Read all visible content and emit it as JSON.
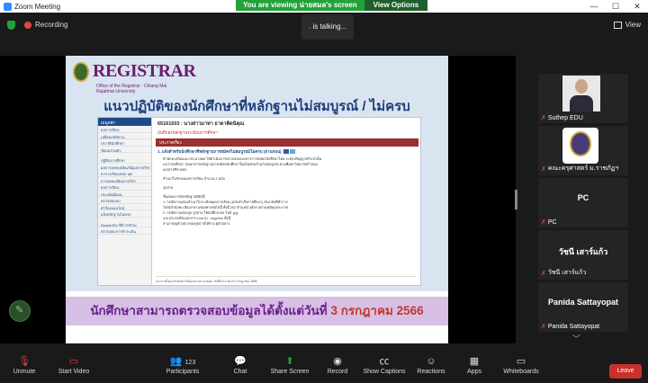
{
  "window": {
    "title": "Zoom Meeting",
    "controls": [
      "—",
      "☐",
      "✕"
    ]
  },
  "share_banner": {
    "viewing": "You are viewing น่ายสมล's screen",
    "options": "View Options"
  },
  "top": {
    "recording": "Recording",
    "talking": ". is talking...",
    "view": "View"
  },
  "slide": {
    "logo": {
      "mark": "REGISTRAR",
      "small": "Office of the Registrar · Chiang Mai Rajabhat University"
    },
    "title": "แนวปฏิบัติของนักศึกษาที่หลักฐานไม่สมบูรณ์ / ไม่ครบ",
    "web": {
      "sidebar_header": "เมนูหลัก",
      "sidebar_items": [
        "ผลการเรียน",
        "เปลี่ยนรหัสผ่าน",
        "ประวัตินักศึกษา",
        "ข้อมูลส่วนตัว",
        "",
        "ปฏิทินการศึกษา",
        "ผลการลงทะเบียน/ข้อมูลรายวิชา",
        "ตารางเรียน/สอบ นศ.",
        "การลงทะเบียนรายวิชา",
        "ผลการเรียน",
        "ประเมินผู้สอน",
        "ตรวจสอบจบ",
        "คำร้องออนไลน์",
        "แจ้งหลักฐานไม่ครบ",
        "",
        "Regist/ประวัติการชำระ",
        "ตรวจสอบการชำระเงิน"
      ],
      "student_id": "65161503 : นางสาวมาทา ธาดาคิดนิคุณ",
      "crumb": "บันทึกส่งหลักฐานระเบียนการศึกษา",
      "bar": "ประกาศเรื่อง",
      "headline": "1. แจ้งสำหรับนักศึกษาที่หลักฐานการสมัครไม่สมบูรณ์/ไม่ครบ (อ่านก่อน)",
      "lines": [
        "สำนักทะเบียนและประมวลผล ได้ดำเนินการตรวจสอบเอกสารการสมัครนักศึกษาใหม่ ระดับปริญญาตรี แล้วนั้น",
        "พบว่านักศึกษา ส่งเอกสารหลักฐานการสมัครนักศึกษาใหม่ไม่ครบถ้วน/ไม่สมบูรณ์ ตามที่มหาวิทยาลัยกำหนด",
        "เอกสารที่ขาดส่ง",
        "",
        "สำเนาใบรับรองผลการเรียน จำนวน 2 ฉบับ",
        "",
        "รูปถ่าย",
        "",
        "ขั้นตอนการส่งหลักฐานมีดังนี้",
        "1. กรณีจากแสดงสำเนาใบระเบียนผลการเรียน (ฉบับสำเร็จการศึกษา) ส่งมายังที่ทำการ",
        "ไปยังสำนักทะเบียนฯ ผ่านช่องทางต่อไปนี้ ทั้งนี้ 202 ด้านหน้าเลือก อย่างเหมือนประกาศ",
        "2. กรณีจากแสดงรูป รูปถ่าย ให้นักศึกษาส่ง ไฟล์ .jpg",
        "และประสงค์รับเอกสาร Line ID : regcmru ทั้งนี้",
        "สามารถดูตัวอย่างของรูปถ่ายได้ทาง ดูตัวอย่าง"
      ],
      "footer": "ประกาศโดย   สำนักทะเบียนและประมวลผล   วันที่ประกาศ   20 กรกฎาคม 2565"
    },
    "notice_prefix": "นักศึกษาสามารถตรวจสอบข้อมูลได้ตั้งแต่วันที่",
    "notice_date": "3 กรกฎาคม 2566"
  },
  "participants": [
    {
      "name": "Suthep EDU"
    },
    {
      "name": "คณะครุศาสตร์ ม.ราชภัฏฯ"
    },
    {
      "name": "PC",
      "big": "PC"
    },
    {
      "name": "วัชนี เสาร์แก้ว",
      "big": "วัชนี เสาร์แก้ว"
    },
    {
      "name": "Panida Sattayopat",
      "big": "Panida Sattayopat"
    }
  ],
  "toolbar": {
    "unmute": "Unmute",
    "start_video": "Start Video",
    "participants": "Participants",
    "participant_count": "123",
    "chat": "Chat",
    "share": "Share Screen",
    "record": "Record",
    "captions": "Show Captions",
    "reactions": "Reactions",
    "apps": "Apps",
    "whiteboards": "Whiteboards",
    "leave": "Leave"
  }
}
